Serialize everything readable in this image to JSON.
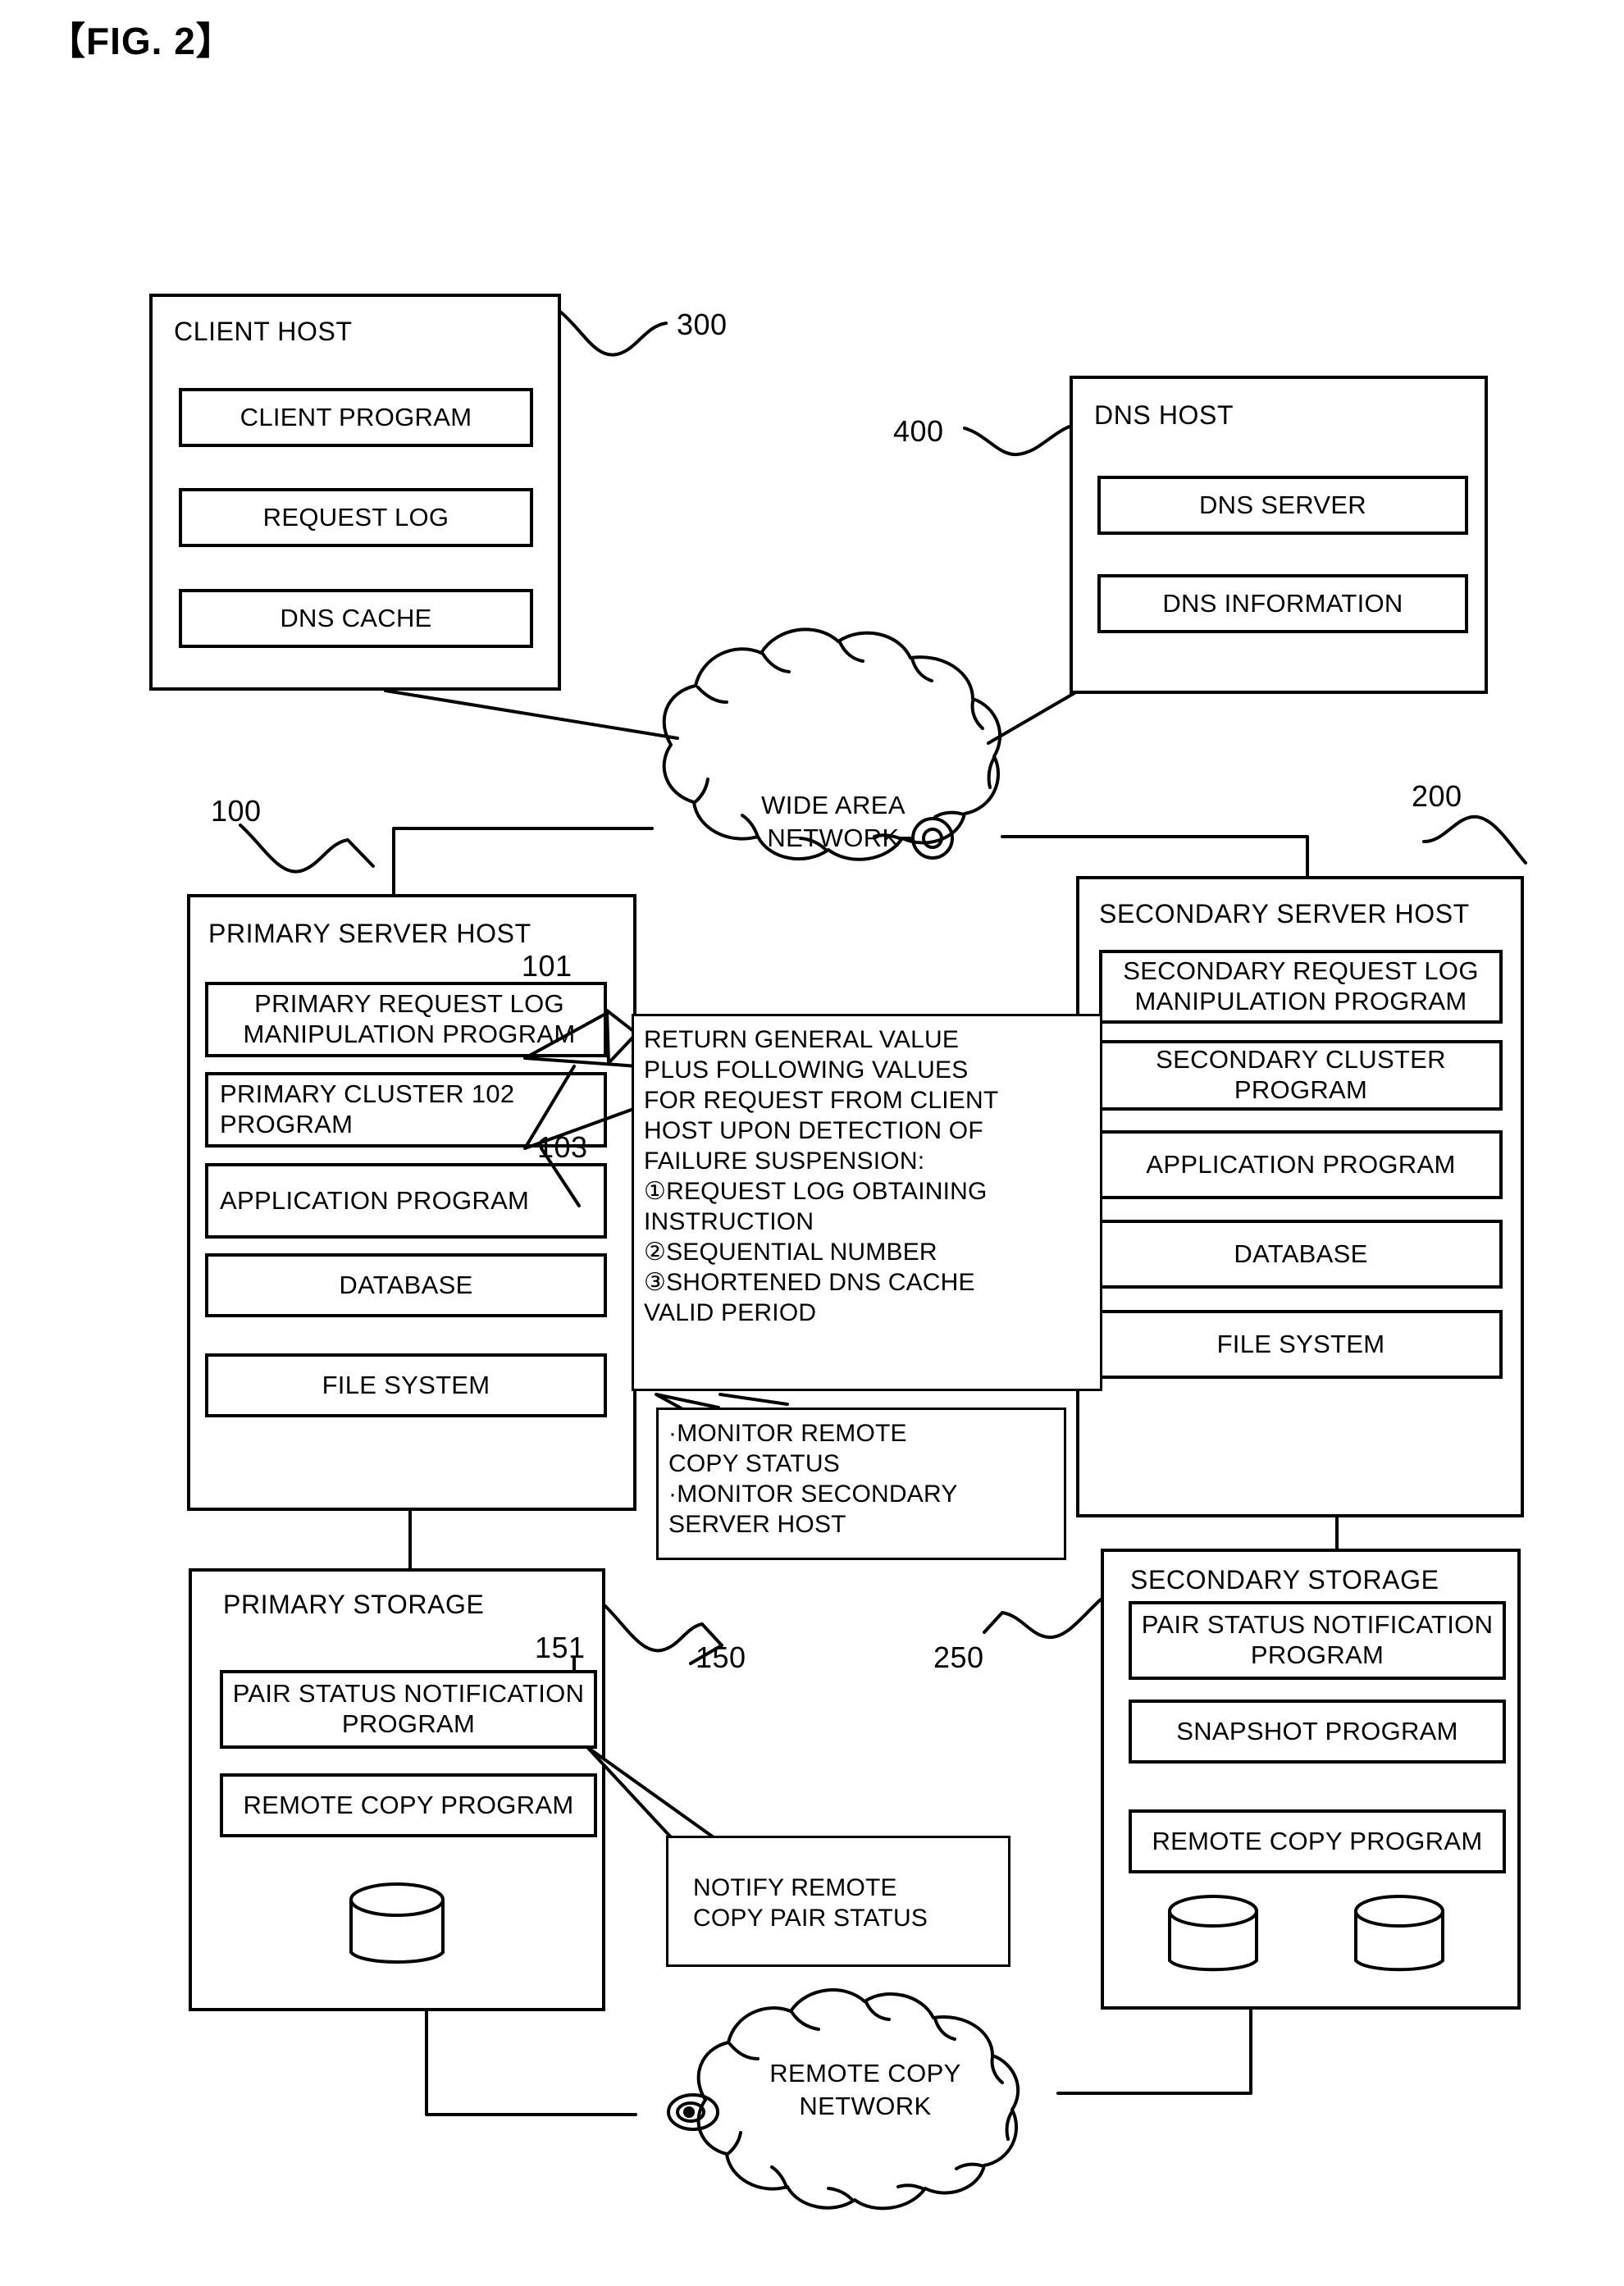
{
  "figure": {
    "label": "【FIG. 2】"
  },
  "client_host": {
    "title": "CLIENT HOST",
    "ref": "300",
    "items": [
      {
        "label": "CLIENT PROGRAM"
      },
      {
        "label": "REQUEST LOG"
      },
      {
        "label": "DNS CACHE"
      }
    ]
  },
  "dns_host": {
    "title": "DNS HOST",
    "ref": "400",
    "items": [
      {
        "label": "DNS SERVER"
      },
      {
        "label": "DNS INFORMATION"
      }
    ]
  },
  "wide_area_network": {
    "label": "WIDE AREA\nNETWORK"
  },
  "remote_copy_network": {
    "label": "REMOTE COPY\nNETWORK"
  },
  "primary_server_host": {
    "title": "PRIMARY SERVER HOST",
    "ref": "100",
    "items": [
      {
        "label": "PRIMARY REQUEST LOG\nMANIPULATION PROGRAM",
        "ref": "101"
      },
      {
        "label": "PRIMARY CLUSTER  102\nPROGRAM",
        "ref": "102"
      },
      {
        "label": "APPLICATION PROGRAM",
        "ref": "103"
      },
      {
        "label": "DATABASE",
        "ref": ""
      },
      {
        "label": "FILE SYSTEM",
        "ref": ""
      }
    ],
    "item_refs": {
      "r101": "101",
      "r103": "103"
    }
  },
  "secondary_server_host": {
    "title": "SECONDARY SERVER HOST",
    "ref": "200",
    "items": [
      {
        "label": "SECONDARY REQUEST LOG\nMANIPULATION PROGRAM"
      },
      {
        "label": "SECONDARY CLUSTER\nPROGRAM"
      },
      {
        "label": "APPLICATION PROGRAM"
      },
      {
        "label": "DATABASE"
      },
      {
        "label": "FILE SYSTEM"
      }
    ]
  },
  "primary_storage": {
    "title": "PRIMARY STORAGE",
    "ref": "150",
    "inner_ref": "151",
    "items": [
      {
        "label": "PAIR STATUS\nNOTIFICATION PROGRAM"
      },
      {
        "label": "REMOTE COPY PROGRAM"
      }
    ]
  },
  "secondary_storage": {
    "title": "SECONDARY STORAGE",
    "ref": "250",
    "items": [
      {
        "label": "PAIR STATUS\nNOTIFICATION PROGRAM"
      },
      {
        "label": "SNAPSHOT PROGRAM"
      },
      {
        "label": "REMOTE COPY PROGRAM"
      }
    ]
  },
  "notes": {
    "return_values": "RETURN GENERAL VALUE\nPLUS FOLLOWING VALUES\nFOR REQUEST FROM CLIENT\nHOST UPON DETECTION OF\nFAILURE SUSPENSION:\n①REQUEST LOG OBTAINING\nINSTRUCTION\n②SEQUENTIAL NUMBER\n③SHORTENED DNS CACHE\nVALID PERIOD",
    "monitor": "·MONITOR REMOTE\nCOPY STATUS\n·MONITOR SECONDARY\nSERVER HOST",
    "notify_pair_status": "NOTIFY REMOTE\nCOPY PAIR STATUS"
  },
  "colors": {
    "ink": "#000000",
    "paper": "#ffffff"
  }
}
